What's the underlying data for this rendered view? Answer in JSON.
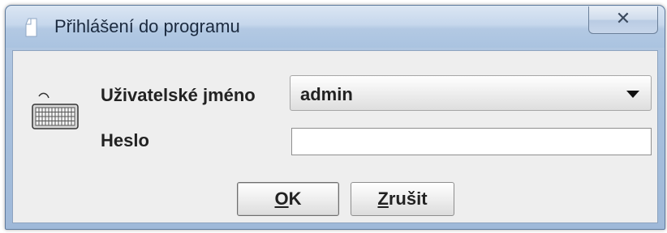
{
  "window": {
    "title": "Přihlášení do programu",
    "close_glyph": "✕"
  },
  "icons": {
    "app": "document-icon",
    "form": "keyboard-icon",
    "close": "close-icon",
    "combo_arrow": "chevron-down-icon"
  },
  "form": {
    "username_label": "Uživatelské jméno",
    "username_value": "admin",
    "password_label": "Heslo",
    "password_value": ""
  },
  "buttons": {
    "ok_mnemonic": "O",
    "ok_rest": "K",
    "cancel_mnemonic": "Z",
    "cancel_rest": "rušit"
  },
  "colors": {
    "titlebar": "#c6d7ec",
    "client_bg": "#eeeeee"
  }
}
